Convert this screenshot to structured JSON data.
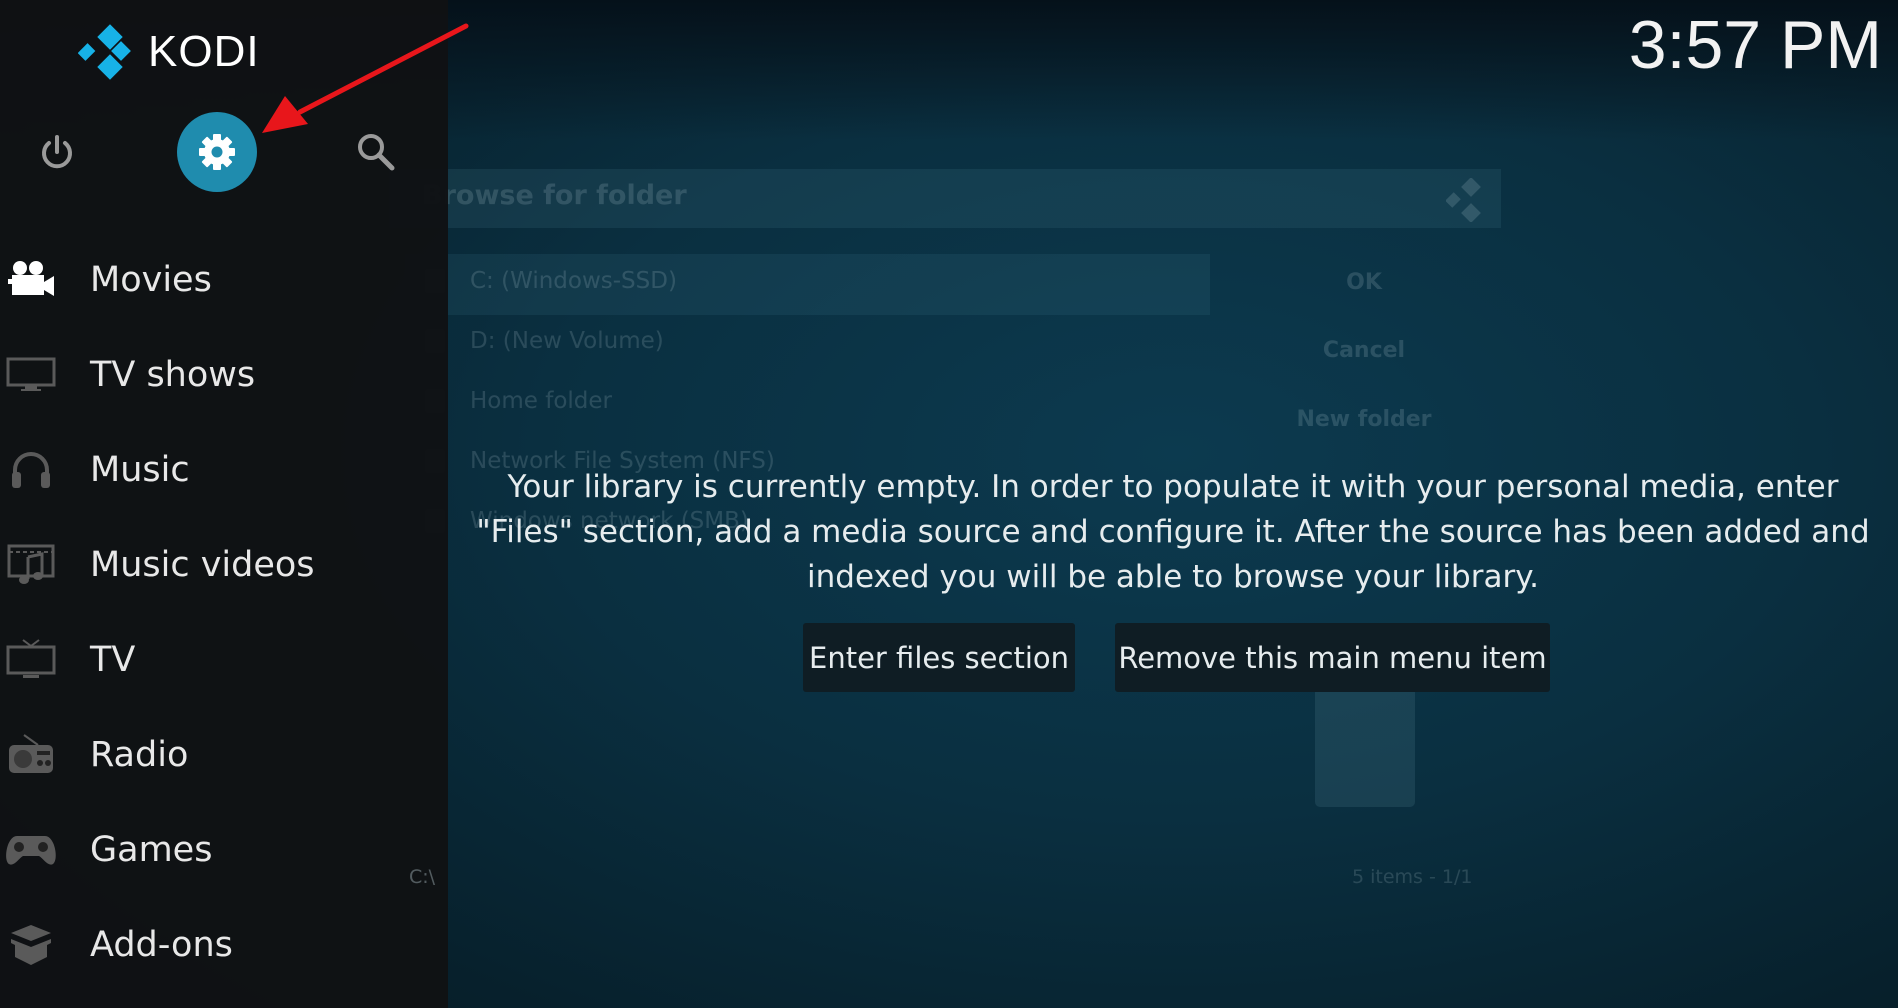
{
  "app": {
    "name": "KODI",
    "clock": "3:57 PM",
    "accent": "#1f8cae",
    "logo_color": "#17b2e7"
  },
  "top_buttons": [
    {
      "name": "power",
      "icon": "power-icon"
    },
    {
      "name": "settings",
      "icon": "gear-icon",
      "active": true
    },
    {
      "name": "search",
      "icon": "search-icon"
    }
  ],
  "menu": [
    {
      "label": "Movies",
      "icon": "movie-camera-icon"
    },
    {
      "label": "TV shows",
      "icon": "monitor-icon"
    },
    {
      "label": "Music",
      "icon": "headphones-icon"
    },
    {
      "label": "Music videos",
      "icon": "music-video-icon"
    },
    {
      "label": "TV",
      "icon": "tv-icon"
    },
    {
      "label": "Radio",
      "icon": "radio-icon"
    },
    {
      "label": "Games",
      "icon": "gamepad-icon"
    },
    {
      "label": "Add-ons",
      "icon": "addons-box-icon"
    }
  ],
  "background_dialog": {
    "title": "Browse for folder",
    "items": [
      "C: (Windows-SSD)",
      "D: (New Volume)",
      "Home folder",
      "Network File System (NFS)",
      "Windows network (SMB)"
    ],
    "buttons": [
      "OK",
      "Cancel",
      "New folder"
    ],
    "path": "C:\\",
    "count": "5 items - 1/1"
  },
  "message": {
    "lines": [
      "Your library is currently empty. In order to populate it with your personal media, enter",
      "\"Files\" section, add a media source and configure it. After the source has been added and",
      "indexed you will be able to browse your library."
    ]
  },
  "actions": {
    "enter_files": "Enter files section",
    "remove_item": "Remove this main menu item"
  },
  "annotation": {
    "arrow_color": "#e8161b"
  }
}
